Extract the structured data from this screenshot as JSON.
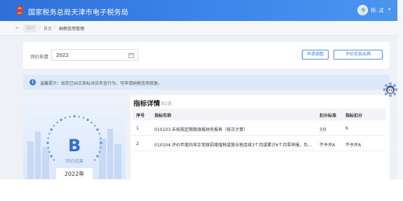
{
  "header": {
    "title": "国家税务总局天津市电子税务局",
    "user_name": "杨..试",
    "caret": "▾"
  },
  "breadcrumb": {
    "back_arrow": "←",
    "back_tag": "返回",
    "separator": "/",
    "home": "首页",
    "current": "纳税信用管理"
  },
  "filter": {
    "year_label": "评价年度",
    "year_value": "2022",
    "apply_button": "申请调整",
    "report_button": "评价信息出具"
  },
  "tip": {
    "icon": "i",
    "text": "温馨提示：如您已纠正指标对应失信行为，可申请纳税信用修复。"
  },
  "grade": {
    "letter": "B",
    "result_label": "评价结果",
    "year": "2022年"
  },
  "details": {
    "title": "指标详情",
    "count": "共2条",
    "columns": [
      "序号",
      "指标名称",
      "扣分标准",
      "指标扣分"
    ],
    "rows": [
      {
        "index": "1",
        "name": "010103.未按规定期限填报财务报表（按次计算）",
        "standard": "3分",
        "score": "6"
      },
      {
        "index": "2",
        "name": "010104.评价年度内非正常原因增值税或营业税连续3个月或累计6个月零申报、负...",
        "standard": "不予评A",
        "score": "不予评A"
      }
    ]
  },
  "icons": {
    "emblem": "emblem-icon",
    "avatar": "avatar-icon",
    "calendar": "calendar-icon",
    "info": "info-icon",
    "widget": "assistant-icon"
  },
  "colors": {
    "primary": "#3b7fe6",
    "header_start": "#2f6fd6",
    "tip_bg": "#dce9fb",
    "grade": "#2f6fd6"
  }
}
